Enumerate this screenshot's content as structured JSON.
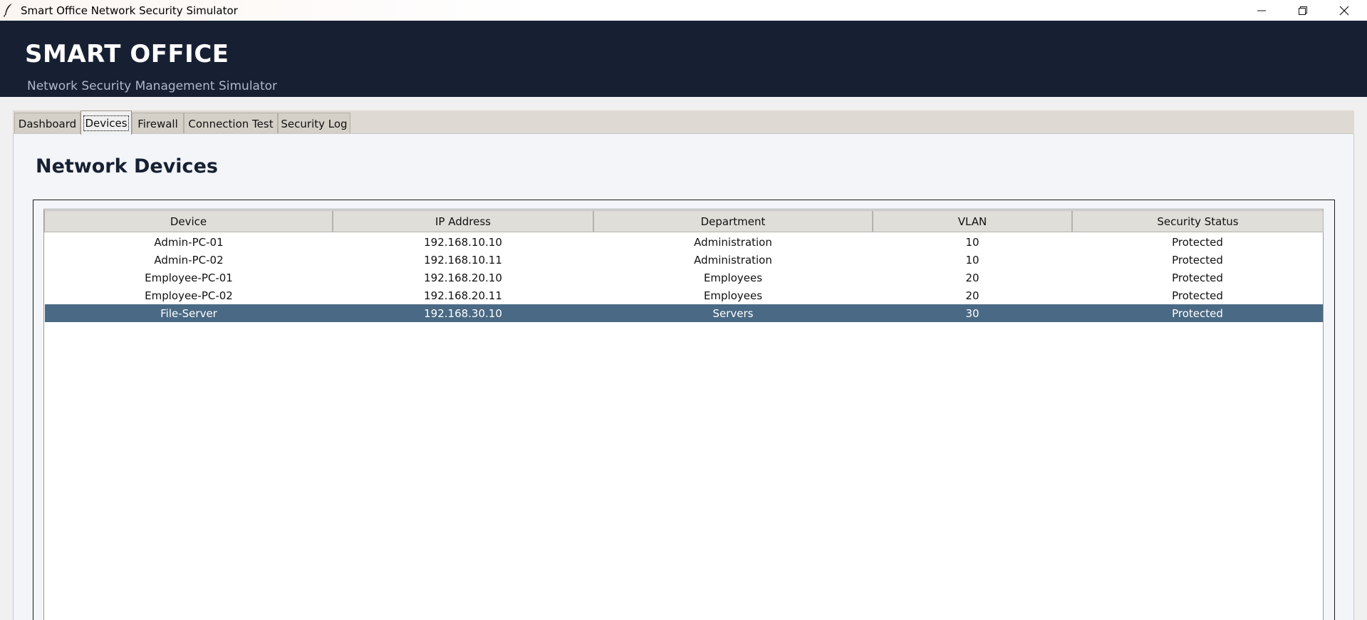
{
  "window": {
    "title": "Smart Office Network Security Simulator",
    "icon": "feather-icon",
    "controls": [
      "minimize-icon",
      "restore-icon",
      "close-icon"
    ]
  },
  "header": {
    "brand": "SMART OFFICE",
    "subtitle": "Network Security Management Simulator"
  },
  "tabs": [
    {
      "label": "Dashboard",
      "active": false
    },
    {
      "label": "Devices",
      "active": true
    },
    {
      "label": "Firewall",
      "active": false
    },
    {
      "label": "Connection Test",
      "active": false
    },
    {
      "label": "Security Log",
      "active": false
    }
  ],
  "page": {
    "title": "Network Devices"
  },
  "table": {
    "columns": [
      "Device",
      "IP Address",
      "Department",
      "VLAN",
      "Security Status"
    ],
    "rows": [
      {
        "device": "Admin-PC-01",
        "ip": "192.168.10.10",
        "department": "Administration",
        "vlan": "10",
        "status": "Protected",
        "selected": false
      },
      {
        "device": "Admin-PC-02",
        "ip": "192.168.10.11",
        "department": "Administration",
        "vlan": "10",
        "status": "Protected",
        "selected": false
      },
      {
        "device": "Employee-PC-01",
        "ip": "192.168.20.10",
        "department": "Employees",
        "vlan": "20",
        "status": "Protected",
        "selected": false
      },
      {
        "device": "Employee-PC-02",
        "ip": "192.168.20.11",
        "department": "Employees",
        "vlan": "20",
        "status": "Protected",
        "selected": false
      },
      {
        "device": "File-Server",
        "ip": "192.168.30.10",
        "department": "Servers",
        "vlan": "30",
        "status": "Protected",
        "selected": true
      }
    ]
  },
  "colors": {
    "header_bg": "#172033",
    "subtitle": "#aeb8c8",
    "selection": "#4a6984"
  }
}
